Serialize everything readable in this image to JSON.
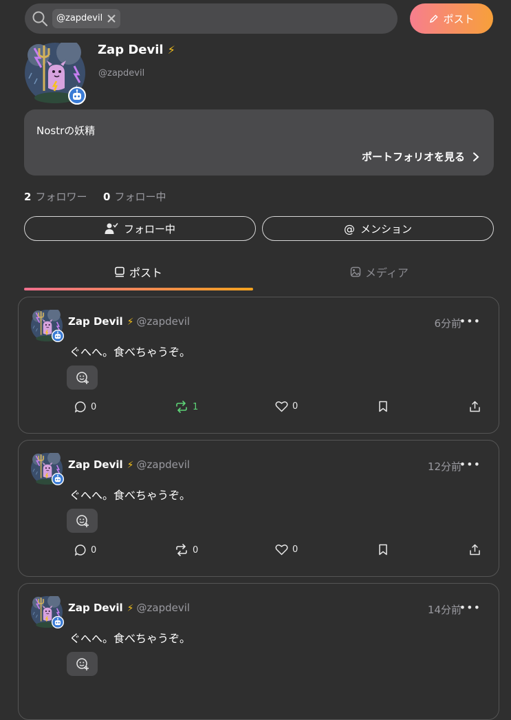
{
  "search": {
    "chip": "@zapdevil"
  },
  "post_button": {
    "label": "ポスト"
  },
  "profile": {
    "name": "Zap Devil",
    "bolt": "⚡",
    "handle": "@zapdevil",
    "bio": "Nostrの妖精",
    "portfolio_link": "ポートフォリオを見る",
    "followers_count": "2",
    "followers_label": "フォロワー",
    "following_count": "0",
    "following_label": "フォロー中"
  },
  "actions": {
    "following_btn": "フォロー中",
    "mention_btn": "メンション"
  },
  "tabs": [
    {
      "label": "ポスト",
      "active": true
    },
    {
      "label": "メディア",
      "active": false
    }
  ],
  "posts": [
    {
      "name": "Zap Devil",
      "handle": "@zapdevil",
      "time": "6分前",
      "text": "ぐへへ。食べちゃうぞ。",
      "replies": "0",
      "reposts": "1",
      "likes": "0",
      "reposted": true
    },
    {
      "name": "Zap Devil",
      "handle": "@zapdevil",
      "time": "12分前",
      "text": "ぐへへ。食べちゃうぞ。",
      "replies": "0",
      "reposts": "0",
      "likes": "0",
      "reposted": false
    },
    {
      "name": "Zap Devil",
      "handle": "@zapdevil",
      "time": "14分前",
      "text": "ぐへへ。食べちゃうぞ。",
      "replies": "",
      "reposts": "",
      "likes": "",
      "reposted": false
    }
  ],
  "colors": {
    "background": "#2f2f2f",
    "accent_start": "#f77e8e",
    "accent_end": "#f7a03a",
    "repost_active": "#5dd477",
    "bolt": "#f7c21a"
  }
}
